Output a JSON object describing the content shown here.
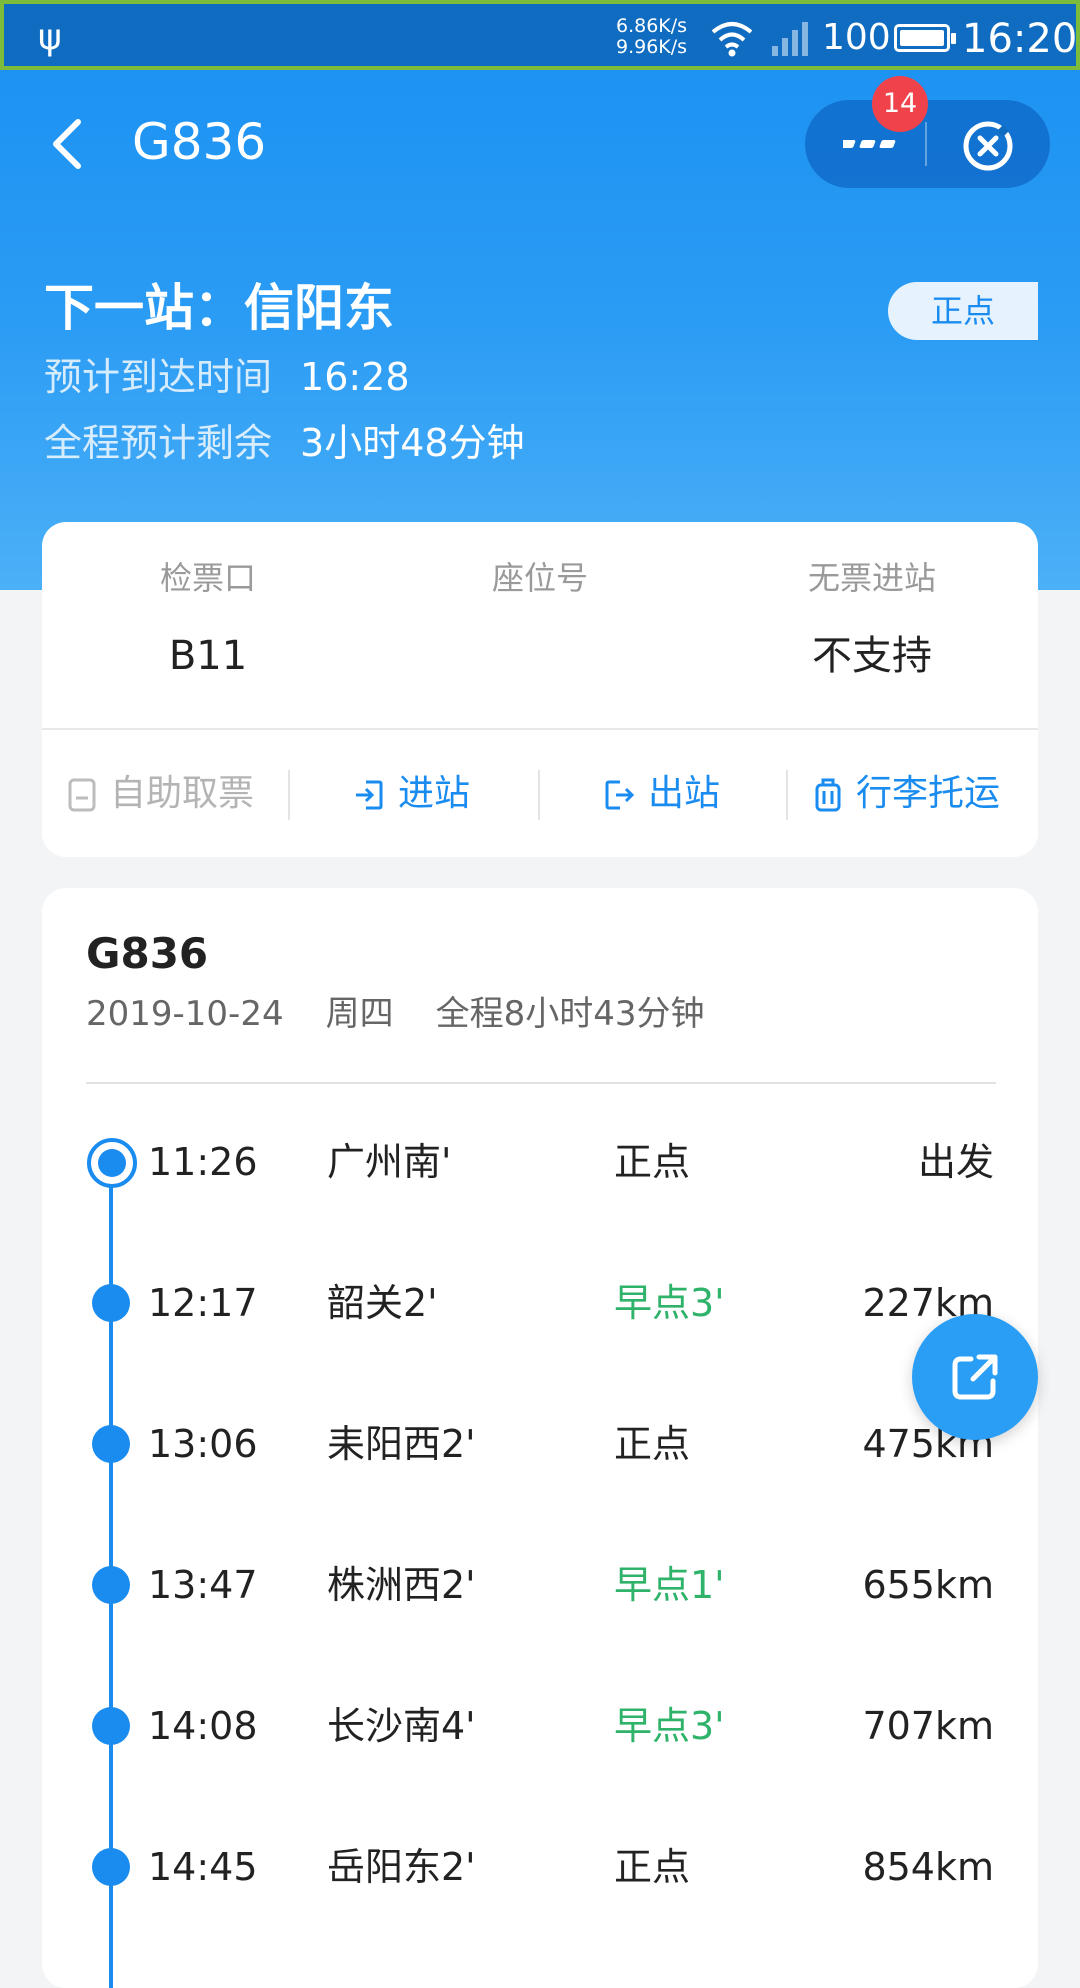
{
  "status_bar": {
    "speed_up": "6.86K/s",
    "speed_down": "9.96K/s",
    "battery": "100",
    "time": "16:20"
  },
  "header": {
    "title": "G836",
    "badge_count": "14"
  },
  "summary": {
    "next_station": "下一站：信阳东",
    "status_pill": "正点",
    "arrival_label": "预计到达时间",
    "arrival_value": "16:28",
    "remaining_label": "全程预计剩余",
    "remaining_value": "3小时48分钟"
  },
  "ticket_info": {
    "cells": [
      {
        "label": "检票口",
        "value": "B11"
      },
      {
        "label": "座位号",
        "value": ""
      },
      {
        "label": "无票进站",
        "value": "不支持"
      }
    ],
    "actions": [
      {
        "label": "自助取票",
        "enabled": false
      },
      {
        "label": "进站",
        "enabled": true
      },
      {
        "label": "出站",
        "enabled": true
      },
      {
        "label": "行李托运",
        "enabled": true
      }
    ]
  },
  "schedule": {
    "train": "G836",
    "date": "2019-10-24",
    "weekday": "周四",
    "duration": "全程8小时43分钟",
    "stops": [
      {
        "time": "11:26",
        "station": "广州南'",
        "status": "正点",
        "info": "出发",
        "early": false
      },
      {
        "time": "12:17",
        "station": "韶关2'",
        "status": "早点3'",
        "info": "227km",
        "early": true
      },
      {
        "time": "13:06",
        "station": "耒阳西2'",
        "status": "正点",
        "info": "475km",
        "early": false
      },
      {
        "time": "13:47",
        "station": "株洲西2'",
        "status": "早点1'",
        "info": "655km",
        "early": true
      },
      {
        "time": "14:08",
        "station": "长沙南4'",
        "status": "早点3'",
        "info": "707km",
        "early": true
      },
      {
        "time": "14:45",
        "station": "岳阳东2'",
        "status": "正点",
        "info": "854km",
        "early": false
      }
    ]
  },
  "colors": {
    "accent": "#1a8cf0",
    "early": "#2fb36a",
    "badge": "#f0424a"
  }
}
